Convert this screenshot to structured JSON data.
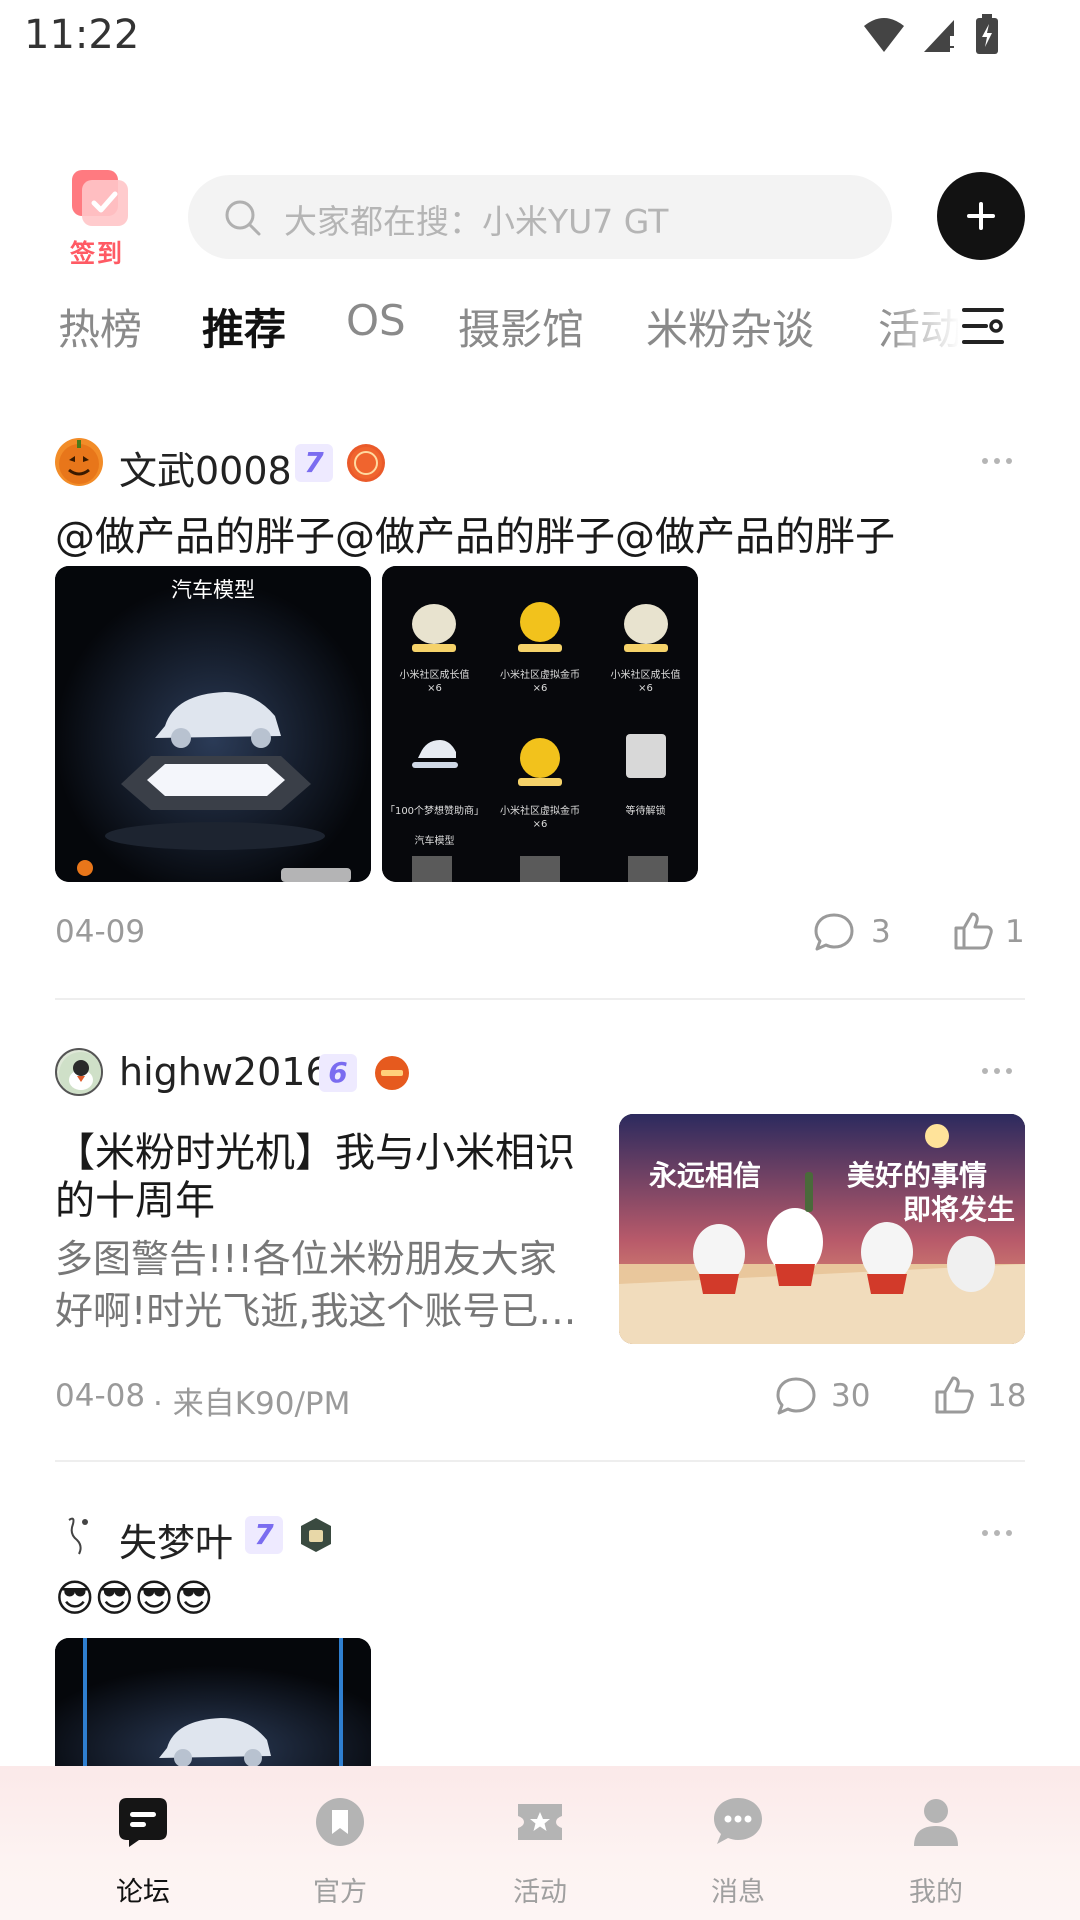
{
  "status_bar": {
    "time": "11:22"
  },
  "header": {
    "checkin_label": "签到",
    "search_placeholder": "大家都在搜：小米YU7 GT"
  },
  "tabs": [
    "热榜",
    "推荐",
    "OS",
    "摄影馆",
    "米粉杂谈",
    "活动"
  ],
  "active_tab": "推荐",
  "posts": [
    {
      "author": "文武0008",
      "level": "7",
      "title": "@做产品的胖子@做产品的胖子@做产品的胖子",
      "image_caption": "汽车模型",
      "grid_labels": [
        "小米社区成长值",
        "小米社区虚拟金币",
        "小米社区成长值",
        "「100个梦想赞助商」",
        "小米社区虚拟金币",
        "等待解锁"
      ],
      "grid_counts": [
        "×6",
        "×6",
        "×6",
        "×6"
      ],
      "grid_sub": "汽车模型",
      "date": "04-09",
      "comments": "3",
      "likes": "1"
    },
    {
      "author": "highw2016",
      "level": "6",
      "title_line1": "【米粉时光机】我与小米相识",
      "title_line2": "的十周年",
      "excerpt_line1": "多图警告!!!各位米粉朋友大家",
      "excerpt_line2": "好啊!时光飞逝,我这个账号已…",
      "image_text_left": "永远相信",
      "image_text_right1": "美好的事情",
      "image_text_right2": "即将发生",
      "date": "04-08",
      "source": "· 来自K90/PM",
      "comments": "30",
      "likes": "18"
    },
    {
      "author": "失梦叶",
      "level": "7",
      "title": "😎😎😎😎"
    }
  ],
  "bottom_nav": [
    {
      "label": "论坛",
      "icon": "forum-icon",
      "active": true
    },
    {
      "label": "官方",
      "icon": "official-icon",
      "active": false
    },
    {
      "label": "活动",
      "icon": "activity-icon",
      "active": false
    },
    {
      "label": "消息",
      "icon": "message-icon",
      "active": false
    },
    {
      "label": "我的",
      "icon": "profile-icon",
      "active": false
    }
  ],
  "colors": {
    "accent": "#ff5a64",
    "level_badge_bg": "#eeeaff",
    "level_badge_text": "#7a6cf0",
    "meta_text": "#9a9a9a"
  }
}
